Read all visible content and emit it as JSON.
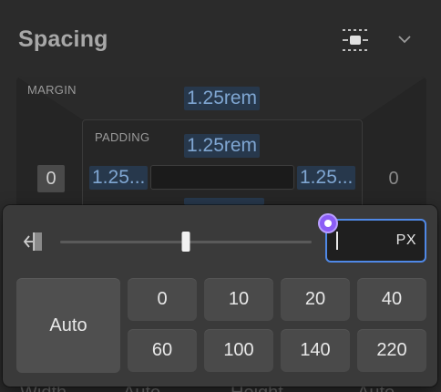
{
  "panel": {
    "title": "Spacing",
    "icons": {
      "align": "align-center-icon",
      "collapse": "chevron-down-icon"
    }
  },
  "box_model": {
    "margin_label": "MARGIN",
    "padding_label": "PADDING",
    "margin_top": "1.25rem",
    "margin_left": "0",
    "margin_right": "0",
    "padding_top": "1.25rem",
    "padding_left": "1.25...",
    "padding_right": "1.25...",
    "colors": {
      "value_bg": "#27384c",
      "value_text": "#7fa6d2"
    }
  },
  "popover": {
    "reset_icon": "reset-left-icon",
    "slider_position": 0.5,
    "input_value": "",
    "unit": "PX",
    "auto_label": "Auto",
    "presets": [
      "0",
      "10",
      "20",
      "40",
      "60",
      "100",
      "140",
      "220"
    ],
    "colors": {
      "input_border": "#4f88e6",
      "badge": "#8b5cf6"
    }
  },
  "bottom_row": {
    "width_label": "Width",
    "width_value": "Auto",
    "height_label": "Height",
    "height_value": "Auto"
  }
}
